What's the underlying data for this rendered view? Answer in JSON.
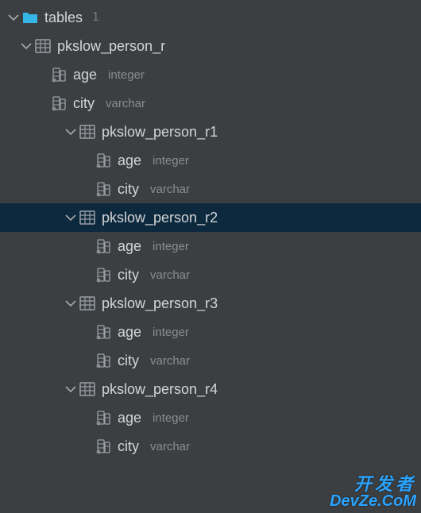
{
  "root": {
    "label": "tables",
    "count": "1"
  },
  "tables": [
    {
      "name": "pkslow_person_r",
      "columns": [
        {
          "name": "age",
          "type": "integer"
        },
        {
          "name": "city",
          "type": "varchar"
        }
      ],
      "children": [
        {
          "name": "pkslow_person_r1",
          "selected": false,
          "columns": [
            {
              "name": "age",
              "type": "integer"
            },
            {
              "name": "city",
              "type": "varchar"
            }
          ]
        },
        {
          "name": "pkslow_person_r2",
          "selected": true,
          "columns": [
            {
              "name": "age",
              "type": "integer"
            },
            {
              "name": "city",
              "type": "varchar"
            }
          ]
        },
        {
          "name": "pkslow_person_r3",
          "selected": false,
          "columns": [
            {
              "name": "age",
              "type": "integer"
            },
            {
              "name": "city",
              "type": "varchar"
            }
          ]
        },
        {
          "name": "pkslow_person_r4",
          "selected": false,
          "columns": [
            {
              "name": "age",
              "type": "integer"
            },
            {
              "name": "city",
              "type": "varchar"
            }
          ]
        }
      ]
    }
  ],
  "watermark": {
    "line1": "开发者",
    "line2": "DevZe.CoM"
  }
}
